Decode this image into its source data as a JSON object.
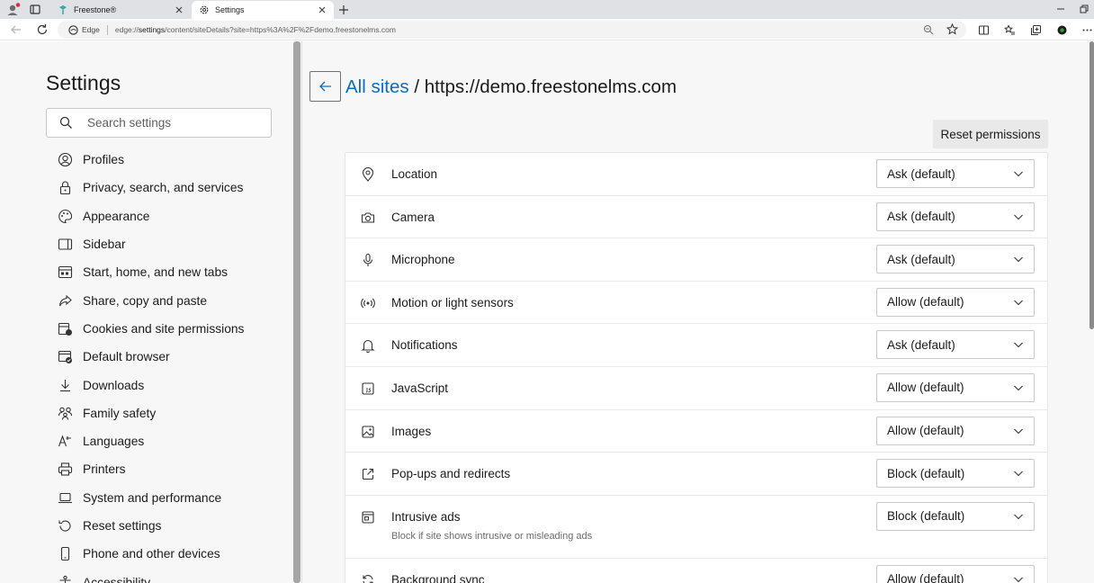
{
  "tabs": [
    {
      "title": "Freestone®",
      "active": false
    },
    {
      "title": "Settings",
      "active": true
    }
  ],
  "address_bar": {
    "edge_label": "Edge",
    "url_prefix": "edge://",
    "url_host": "settings",
    "url_path": "/content/siteDetails?site=https%3A%2F%2Fdemo.freestonelms.com"
  },
  "sidebar": {
    "title": "Settings",
    "search_placeholder": "Search settings",
    "items": [
      {
        "label": "Profiles",
        "icon": "profile-icon"
      },
      {
        "label": "Privacy, search, and services",
        "icon": "lock-icon"
      },
      {
        "label": "Appearance",
        "icon": "palette-icon"
      },
      {
        "label": "Sidebar",
        "icon": "sidebar-icon"
      },
      {
        "label": "Start, home, and new tabs",
        "icon": "home-tabs-icon"
      },
      {
        "label": "Share, copy and paste",
        "icon": "share-icon"
      },
      {
        "label": "Cookies and site permissions",
        "icon": "cookies-icon"
      },
      {
        "label": "Default browser",
        "icon": "default-browser-icon"
      },
      {
        "label": "Downloads",
        "icon": "download-icon"
      },
      {
        "label": "Family safety",
        "icon": "family-icon"
      },
      {
        "label": "Languages",
        "icon": "language-icon"
      },
      {
        "label": "Printers",
        "icon": "printer-icon"
      },
      {
        "label": "System and performance",
        "icon": "laptop-icon"
      },
      {
        "label": "Reset settings",
        "icon": "reset-icon"
      },
      {
        "label": "Phone and other devices",
        "icon": "phone-icon"
      },
      {
        "label": "Accessibility",
        "icon": "accessibility-icon"
      }
    ]
  },
  "main": {
    "breadcrumb_link": "All sites",
    "breadcrumb_sep": " / ",
    "site": "https://demo.freestonelms.com",
    "reset_label": "Reset permissions",
    "permissions": [
      {
        "label": "Location",
        "value": "Ask (default)",
        "icon": "location-icon"
      },
      {
        "label": "Camera",
        "value": "Ask (default)",
        "icon": "camera-icon"
      },
      {
        "label": "Microphone",
        "value": "Ask (default)",
        "icon": "microphone-icon"
      },
      {
        "label": "Motion or light sensors",
        "value": "Allow (default)",
        "icon": "sensors-icon"
      },
      {
        "label": "Notifications",
        "value": "Ask (default)",
        "icon": "bell-icon"
      },
      {
        "label": "JavaScript",
        "value": "Allow (default)",
        "icon": "javascript-icon"
      },
      {
        "label": "Images",
        "value": "Allow (default)",
        "icon": "image-icon"
      },
      {
        "label": "Pop-ups and redirects",
        "value": "Block (default)",
        "icon": "popup-icon"
      },
      {
        "label": "Intrusive ads",
        "value": "Block (default)",
        "icon": "ads-icon",
        "description": "Block if site shows intrusive or misleading ads"
      },
      {
        "label": "Background sync",
        "value": "Allow (default)",
        "icon": "sync-icon"
      }
    ]
  },
  "colors": {
    "accent": "#0f6cbd",
    "panel_bg": "#f7f7f7",
    "card_bg": "#ffffff"
  }
}
